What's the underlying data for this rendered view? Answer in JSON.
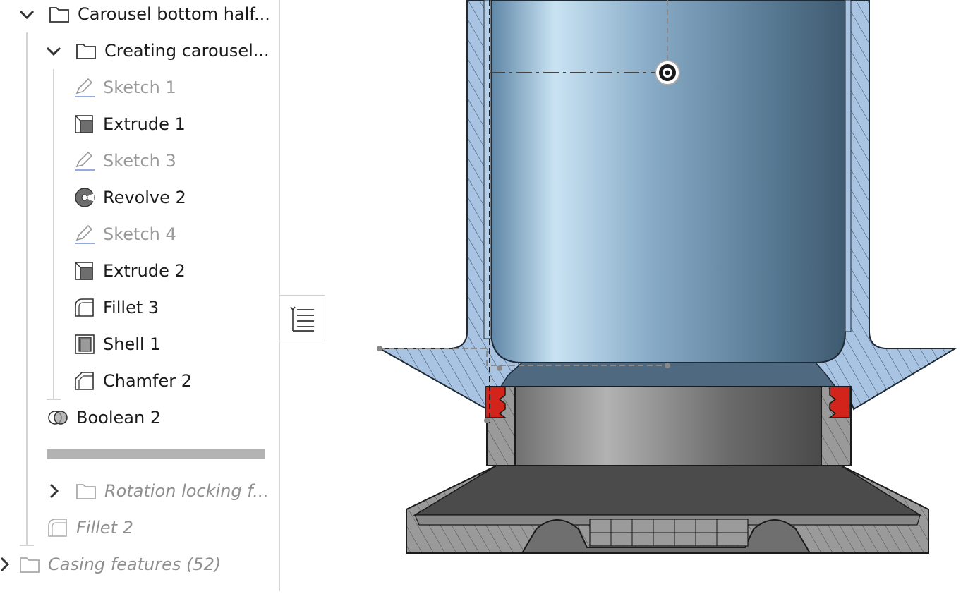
{
  "feature_tree": {
    "items": [
      {
        "label": "Carousel bottom half...",
        "type": "folder",
        "state": "expanded"
      },
      {
        "label": "Creating carousel...",
        "type": "folder",
        "state": "expanded"
      },
      {
        "label": "Sketch 1",
        "type": "sketch",
        "state": "greyed"
      },
      {
        "label": "Extrude 1",
        "type": "extrude"
      },
      {
        "label": "Sketch 3",
        "type": "sketch",
        "state": "greyed"
      },
      {
        "label": "Revolve 2",
        "type": "revolve"
      },
      {
        "label": "Sketch 4",
        "type": "sketch",
        "state": "greyed"
      },
      {
        "label": "Extrude 2",
        "type": "extrude"
      },
      {
        "label": "Fillet 3",
        "type": "fillet"
      },
      {
        "label": "Shell 1",
        "type": "shell"
      },
      {
        "label": "Chamfer 2",
        "type": "chamfer"
      },
      {
        "label": "Boolean 2",
        "type": "boolean"
      },
      {
        "label": "Rotation locking f...",
        "type": "folder",
        "state": "collapsed-suppressed"
      },
      {
        "label": "Fillet 2",
        "type": "fillet",
        "state": "suppressed"
      },
      {
        "label": "Casing features (52)",
        "type": "folder",
        "state": "collapsed-suppressed"
      }
    ]
  },
  "colors": {
    "part_blue": "#7aa3c2",
    "section_blue": "#a9c4e2",
    "seal_red": "#d3241c",
    "part_grey": "#8a8a8a",
    "sketch_icon_blue": "#6f8fd6"
  }
}
